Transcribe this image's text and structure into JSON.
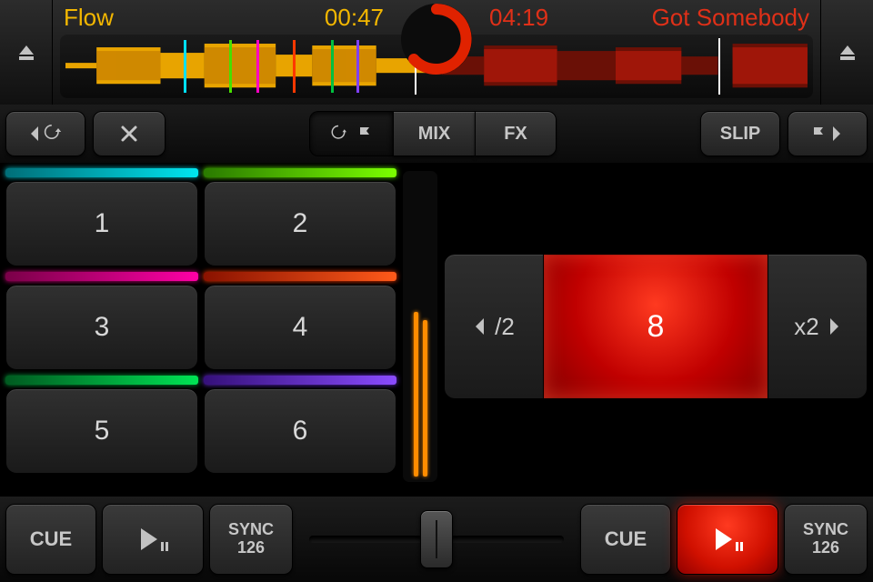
{
  "deckA": {
    "track": "Flow",
    "time": "00:47",
    "cue": "CUE",
    "sync_label": "SYNC",
    "bpm": "126"
  },
  "deckB": {
    "track": "Got Somebody",
    "time": "04:19",
    "cue": "CUE",
    "sync_label": "SYNC",
    "bpm": "126"
  },
  "tabs": {
    "loop_cue_icon_active": true,
    "mix": "MIX",
    "fx": "FX"
  },
  "slip": "SLIP",
  "pads": {
    "p1": "1",
    "p2": "2",
    "p3": "3",
    "p4": "4",
    "p5": "5",
    "p6": "6"
  },
  "pad_colors": {
    "row1_l": "#00b9c4",
    "row1_r": "#58e000",
    "row2_l": "#d4007c",
    "row2_r": "#ff3800",
    "row3_l": "#00a83c",
    "row3_r": "#6a2dd8"
  },
  "beat": {
    "half": "/2",
    "value": "8",
    "double": "x2"
  }
}
